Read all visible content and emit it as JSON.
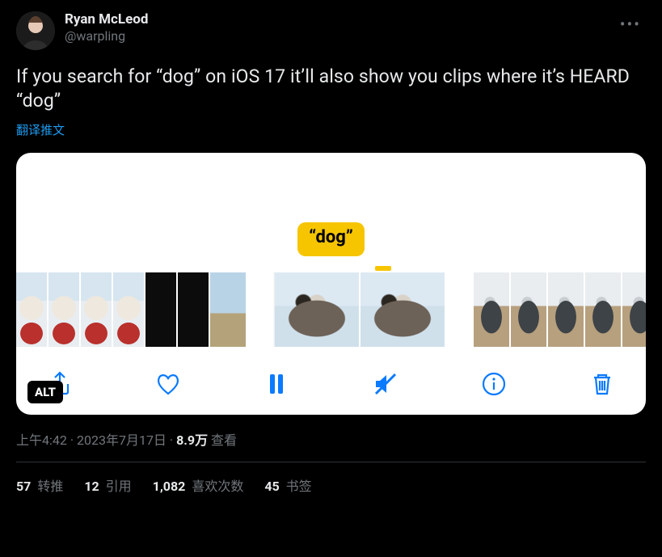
{
  "author": {
    "display_name": "Ryan McLeod",
    "handle": "@warpling"
  },
  "body": "If you search for “dog” on iOS 17 it’ll also show you clips where it’s HEARD “dog”",
  "translate_label": "翻译推文",
  "media": {
    "tag": "“dog”",
    "alt_badge": "ALT"
  },
  "meta": {
    "time": "上午4:42",
    "dot": " · ",
    "date": "2023年7月17日",
    "views_count": "8.9万",
    "views_label": " 查看"
  },
  "stats": {
    "retweets": {
      "count": "57",
      "label": " 转推"
    },
    "quotes": {
      "count": "12",
      "label": " 引用"
    },
    "likes": {
      "count": "1,082",
      "label": " 喜欢次数"
    },
    "bookmarks": {
      "count": "45",
      "label": " 书签"
    }
  }
}
